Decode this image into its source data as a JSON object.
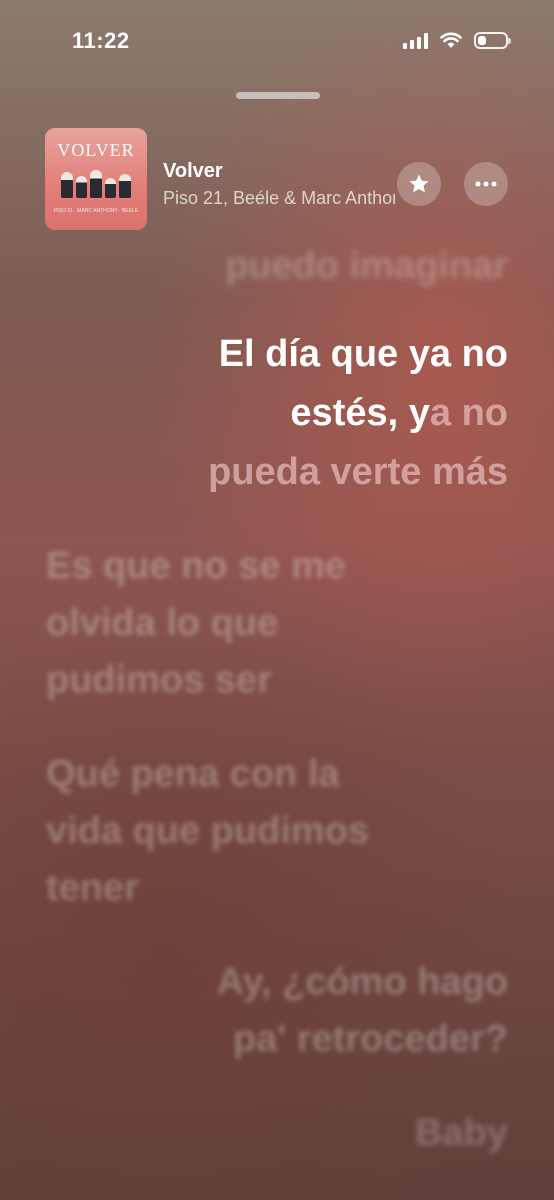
{
  "status_bar": {
    "time": "11:22",
    "icons": [
      "cellular-signal-icon",
      "wifi-icon",
      "battery-icon"
    ],
    "battery_level": 0.3
  },
  "now_playing": {
    "title": "Volver",
    "artist": "Piso 21, Beéle & Marc Anthony",
    "artwork": {
      "title": "VOLVER",
      "credits": "PISO 21 · MARC ANTHONY · BEÉLE"
    },
    "favorite_icon": "star-icon",
    "more_icon": "ellipsis-icon"
  },
  "lyrics": {
    "previous": "puedo imaginar",
    "current": {
      "line1": "El día que ya no",
      "line2_sung": "estés, y",
      "line2_unsung": "a no",
      "line3": "pueda verte más"
    },
    "upcoming": [
      {
        "line1": "Es que no se me",
        "line2": "olvida lo que",
        "line3": "pudimos ser"
      },
      {
        "line1": "Qué pena con la",
        "line2": "vida que pudimos",
        "line3": "tener"
      },
      {
        "line1": "Ay, ¿cómo hago",
        "line2": "pa' retroceder?"
      },
      {
        "line1": "Baby"
      }
    ]
  },
  "colors": {
    "background_top": "#8c7a6f",
    "background_mid": "#8d5650",
    "background_bottom": "#5f3f3b",
    "artwork_pink": "#e3807c"
  }
}
